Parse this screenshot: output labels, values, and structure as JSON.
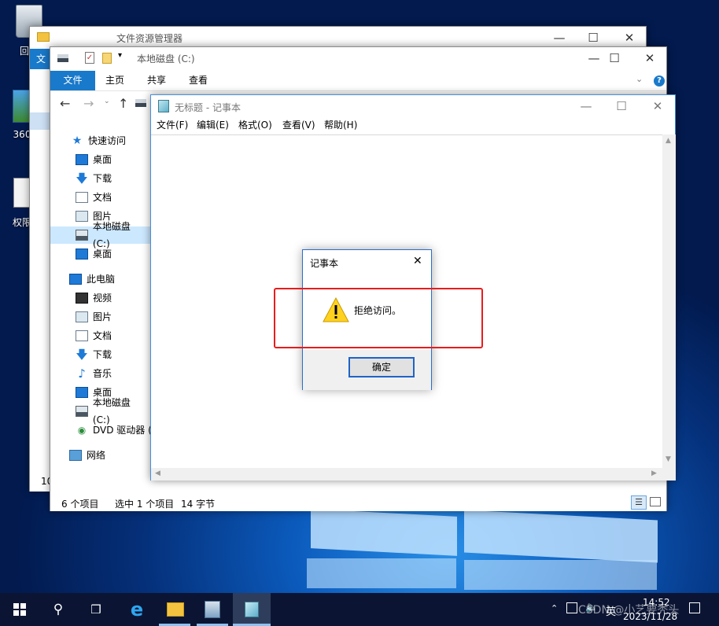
{
  "desktop": {
    "icons": [
      {
        "label": "回收"
      },
      {
        "label": "360"
      },
      {
        "label": "权限"
      }
    ]
  },
  "explorer_back": {
    "title": "文件资源管理器",
    "tab_label": "文",
    "status": "10"
  },
  "explorer": {
    "title": "本地磁盘 (C:)",
    "ribbon_tabs": [
      "文件",
      "主页",
      "共享",
      "查看"
    ],
    "nav": {
      "quick_access": "快速访问",
      "desktop": "桌面",
      "downloads": "下载",
      "documents": "文档",
      "pictures": "图片",
      "local_disk": "本地磁盘 (C:)",
      "desktop2": "桌面",
      "this_pc": "此电脑",
      "videos": "视频",
      "pictures2": "图片",
      "documents2": "文档",
      "downloads2": "下载",
      "music": "音乐",
      "desktop3": "桌面",
      "local_disk2": "本地磁盘 (C:)",
      "dvd": "DVD 驱动器 (",
      "network": "网络"
    },
    "status": {
      "items": "6 个项目",
      "selected": "选中 1 个项目",
      "size": "14 字节"
    }
  },
  "notepad": {
    "title": "无标题 - 记事本",
    "menu": [
      "文件(F)",
      "编辑(E)",
      "格式(O)",
      "查看(V)",
      "帮助(H)"
    ]
  },
  "dialog": {
    "title": "记事本",
    "message": "拒绝访问。",
    "ok_label": "确定"
  },
  "taskbar": {
    "time": "14:52",
    "date": "2023/11/28",
    "ime": "英",
    "watermark": "CSDN @小艺要秃头"
  },
  "colors": {
    "accent": "#1979ca",
    "highlight_box": "#e81c1c",
    "warning": "#ffd21f"
  }
}
